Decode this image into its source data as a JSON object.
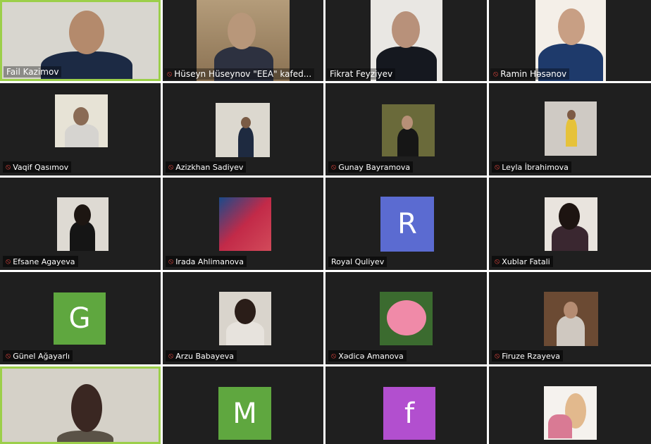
{
  "participants": [
    {
      "name": "Fail Kazimov",
      "muted": false,
      "type": "video"
    },
    {
      "name": "Hüseyn Hüseynov \"EEA\" kafed...",
      "muted": true,
      "type": "video"
    },
    {
      "name": "Fikrat Feyziyev",
      "muted": false,
      "type": "video"
    },
    {
      "name": "Ramin Həsənov",
      "muted": true,
      "type": "video"
    },
    {
      "name": "Vaqif Qasımov",
      "muted": true,
      "type": "photo"
    },
    {
      "name": "Azizkhan Sadiyev",
      "muted": true,
      "type": "photo"
    },
    {
      "name": "Gunay Bayramova",
      "muted": true,
      "type": "photo"
    },
    {
      "name": "Leyla İbrahimova",
      "muted": true,
      "type": "photo"
    },
    {
      "name": "Efsane Agayeva",
      "muted": true,
      "type": "photo"
    },
    {
      "name": "Irada Ahlimanova",
      "muted": true,
      "type": "photo"
    },
    {
      "name": "Royal Quliyev",
      "muted": false,
      "type": "letter",
      "letter": "R",
      "color": "#5b6bd1"
    },
    {
      "name": "Xublar Fatali",
      "muted": true,
      "type": "photo"
    },
    {
      "name": "Günel Ağayarlı",
      "muted": true,
      "type": "letter",
      "letter": "G",
      "color": "#5fa73f"
    },
    {
      "name": "Arzu Babayeva",
      "muted": true,
      "type": "photo"
    },
    {
      "name": "Xədicə Amanova",
      "muted": true,
      "type": "photo"
    },
    {
      "name": "Firuze Rzayeva",
      "muted": true,
      "type": "photo"
    },
    {
      "name": "",
      "muted": false,
      "type": "video"
    },
    {
      "name": "",
      "muted": false,
      "type": "letter",
      "letter": "M",
      "color": "#5fa73f"
    },
    {
      "name": "",
      "muted": false,
      "type": "letter",
      "letter": "f",
      "color": "#b24fcf"
    },
    {
      "name": "",
      "muted": false,
      "type": "photo"
    }
  ],
  "colors": {
    "tile_bg": "#1f1f1f",
    "active_border": "#9ccf4a",
    "mic_muted": "#e0463e"
  },
  "icons": {
    "muted": "mic-muted-icon"
  }
}
